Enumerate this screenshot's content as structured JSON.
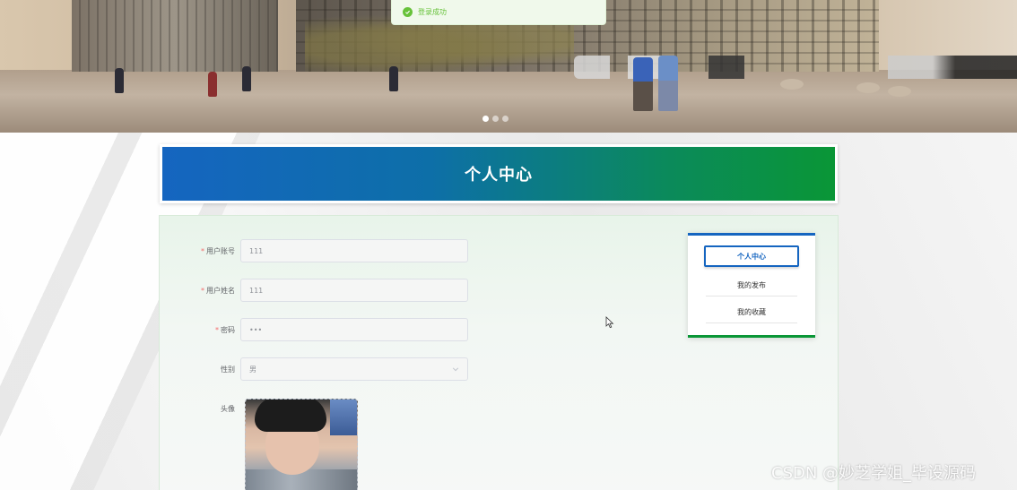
{
  "toast": {
    "message": "登录成功",
    "icon": "check-circle-icon",
    "color": "#67c23a"
  },
  "carousel": {
    "slide_count": 3,
    "active_index": 0
  },
  "title": "个人中心",
  "form": {
    "fields": [
      {
        "label": "用户账号",
        "required": true,
        "value": "111"
      },
      {
        "label": "用户姓名",
        "required": true,
        "value": "111"
      },
      {
        "label": "密码",
        "required": true,
        "value": "•••"
      },
      {
        "label": "性别",
        "required": false,
        "value": "男"
      }
    ],
    "avatar_label": "头像"
  },
  "menu": {
    "items": [
      {
        "label": "个人中心",
        "active": true
      },
      {
        "label": "我的发布",
        "active": false
      },
      {
        "label": "我的收藏",
        "active": false
      }
    ]
  },
  "watermark": "CSDN @妙芝学姐_毕设源码",
  "colors": {
    "primary": "#1565c0",
    "secondary": "#0a9636",
    "required": "#f56c6c"
  }
}
